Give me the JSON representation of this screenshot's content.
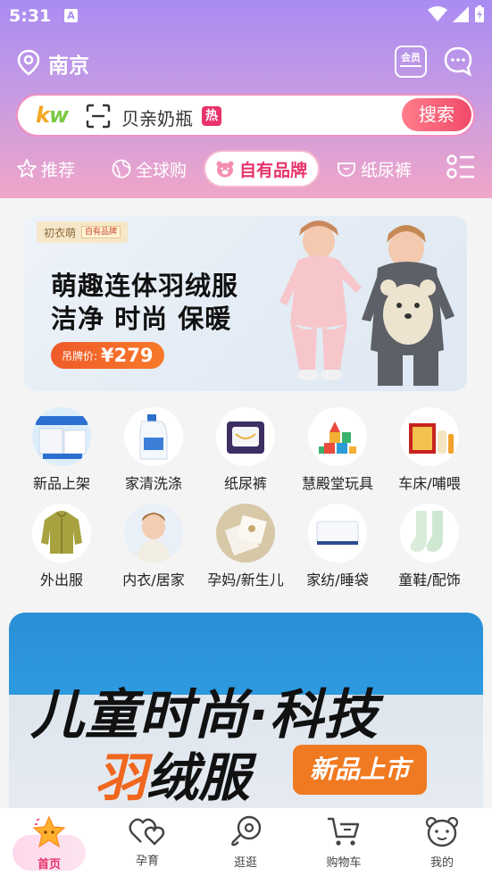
{
  "status": {
    "time": "5:31",
    "notif_icon": "a-notification-icon"
  },
  "header": {
    "city": "南京",
    "member_label": "会员"
  },
  "search": {
    "placeholder": "贝亲奶瓶",
    "hot": "热",
    "button": "搜索",
    "logo_k": "k",
    "logo_w": "w"
  },
  "tabs": [
    {
      "label": "推荐",
      "icon": "star-face-icon"
    },
    {
      "label": "全球购",
      "icon": "globe-icon"
    },
    {
      "label": "自有品牌",
      "icon": "bear-icon",
      "active": true
    },
    {
      "label": "纸尿裤",
      "icon": "diaper-icon"
    }
  ],
  "banner": {
    "brand": "初衣萌",
    "brand_tag": "自有品牌",
    "title1": "萌趣连体羽绒服",
    "title2": "洁净 时尚 保暖",
    "price_label": "吊牌价:",
    "price_value": "¥279"
  },
  "categories": [
    {
      "label": "新品上架"
    },
    {
      "label": "家清洗涤"
    },
    {
      "label": "纸尿裤"
    },
    {
      "label": "慧殿堂玩具"
    },
    {
      "label": "车床/哺喂"
    },
    {
      "label": "外出服"
    },
    {
      "label": "内衣/居家"
    },
    {
      "label": "孕妈/新生儿"
    },
    {
      "label": "家纺/睡袋"
    },
    {
      "label": "童鞋/配饰"
    }
  ],
  "promo": {
    "title1": "儿童时尚·科技",
    "title2_part1": "羽",
    "title2_part2": "绒服",
    "badge": "新品上市"
  },
  "nav": [
    {
      "label": "首页",
      "active": true
    },
    {
      "label": "孕育"
    },
    {
      "label": "逛逛"
    },
    {
      "label": "购物车"
    },
    {
      "label": "我的"
    }
  ],
  "colors": {
    "accent": "#e8336b",
    "gradient_top": "#a98cf2",
    "gradient_bottom": "#f0a6c8",
    "promo_blue": "#2a8fd6",
    "orange": "#f07a22"
  }
}
